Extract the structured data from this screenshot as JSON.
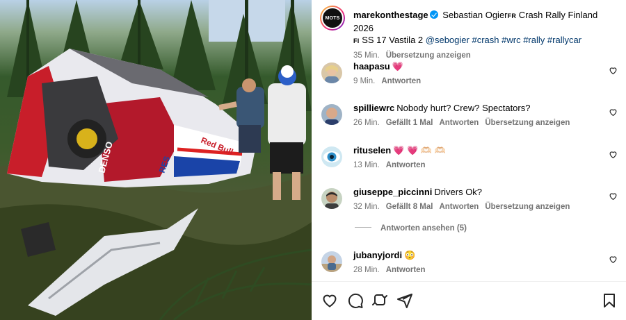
{
  "post": {
    "username": "marekonthestage",
    "avatar_logo_text": "MOTS",
    "caption_main": "Sebastian Ogier",
    "caption_flag_fr": "FR",
    "caption_rest": " Crash Rally Finland 2026",
    "caption_flag_fi": "FI",
    "caption_stage": " SS 17 Vastila 2 ",
    "mention": "@sebogier",
    "hashtags": [
      "#crash",
      "#wrc",
      "#rally",
      "#rallycar"
    ],
    "time": "35 Min.",
    "translation_label": "Übersetzung anzeigen"
  },
  "photo": {
    "sponsor_text": "Red Bull",
    "side_text": "DENSO",
    "door_text": "RES"
  },
  "comments": [
    {
      "username": "haapasu",
      "text": "💗",
      "time": "9 Min.",
      "likes": "",
      "reply_label": "Antworten",
      "translation_label": ""
    },
    {
      "username": "spilliewrc",
      "text": "Nobody hurt? Crew? Spectators?",
      "time": "26 Min.",
      "likes": "Gefällt 1 Mal",
      "reply_label": "Antworten",
      "translation_label": "Übersetzung anzeigen"
    },
    {
      "username": "rituselen",
      "text": "💗 💗 🫶🏻 🫶🏻",
      "time": "13 Min.",
      "likes": "",
      "reply_label": "Antworten",
      "translation_label": ""
    },
    {
      "username": "giuseppe_piccinni",
      "text": "Drivers Ok?",
      "time": "32 Min.",
      "likes": "Gefällt 8 Mal",
      "reply_label": "Antworten",
      "translation_label": "Übersetzung anzeigen"
    },
    {
      "username": "jubanyjordi",
      "text": "😳",
      "time": "28 Min.",
      "likes": "",
      "reply_label": "Antworten",
      "translation_label": ""
    }
  ],
  "view_replies_label": "Antworten ansehen (5)",
  "actions": {
    "icons": [
      "heart-icon",
      "comment-icon",
      "repost-icon",
      "share-icon",
      "bookmark-icon"
    ]
  }
}
